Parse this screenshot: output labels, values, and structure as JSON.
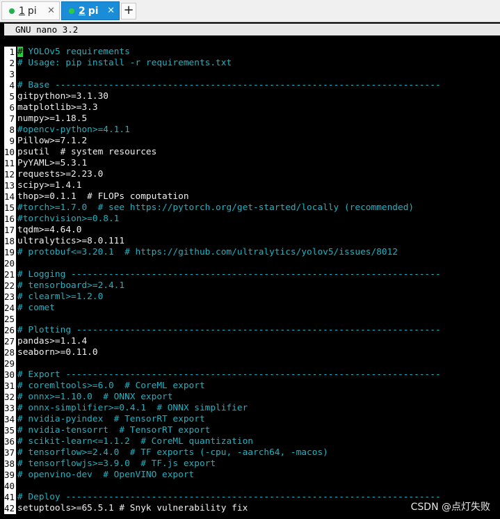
{
  "tabs": [
    {
      "number": "1",
      "label": "pi",
      "active": false
    },
    {
      "number": "2",
      "label": "pi",
      "active": true
    }
  ],
  "add_tab_label": "+",
  "close_glyph": "✕",
  "editor_title": "GNU nano 3.2",
  "colors": {
    "comment": "#1ab4c4",
    "text": "#f0f0f0",
    "active_tab": "#1a8cd8",
    "cursor": "#2ecc40"
  },
  "lines": [
    {
      "n": "1",
      "text": "# YOLOv5 requirements",
      "comment": true
    },
    {
      "n": "2",
      "text": "# Usage: pip install -r requirements.txt",
      "comment": true
    },
    {
      "n": "3",
      "text": "",
      "comment": false
    },
    {
      "n": "4",
      "text": "# Base ------------------------------------------------------------------------",
      "comment": true
    },
    {
      "n": "5",
      "text": "gitpython>=3.1.30",
      "comment": false
    },
    {
      "n": "6",
      "text": "matplotlib>=3.3",
      "comment": false
    },
    {
      "n": "7",
      "text": "numpy>=1.18.5",
      "comment": false
    },
    {
      "n": "8",
      "text": "#opencv-python>=4.1.1",
      "comment": true
    },
    {
      "n": "9",
      "text": "Pillow>=7.1.2",
      "comment": false
    },
    {
      "n": "10",
      "text": "psutil  # system resources",
      "comment": false
    },
    {
      "n": "11",
      "text": "PyYAML>=5.3.1",
      "comment": false
    },
    {
      "n": "12",
      "text": "requests>=2.23.0",
      "comment": false
    },
    {
      "n": "13",
      "text": "scipy>=1.4.1",
      "comment": false
    },
    {
      "n": "14",
      "text": "thop>=0.1.1  # FLOPs computation",
      "comment": false
    },
    {
      "n": "15",
      "text": "#torch>=1.7.0  # see https://pytorch.org/get-started/locally (recommended)",
      "comment": true
    },
    {
      "n": "16",
      "text": "#torchvision>=0.8.1",
      "comment": true
    },
    {
      "n": "17",
      "text": "tqdm>=4.64.0",
      "comment": false
    },
    {
      "n": "18",
      "text": "ultralytics>=8.0.111",
      "comment": false
    },
    {
      "n": "19",
      "text": "# protobuf<=3.20.1  # https://github.com/ultralytics/yolov5/issues/8012",
      "comment": true
    },
    {
      "n": "20",
      "text": "",
      "comment": false
    },
    {
      "n": "21",
      "text": "# Logging ---------------------------------------------------------------------",
      "comment": true
    },
    {
      "n": "22",
      "text": "# tensorboard>=2.4.1",
      "comment": true
    },
    {
      "n": "23",
      "text": "# clearml>=1.2.0",
      "comment": true
    },
    {
      "n": "24",
      "text": "# comet",
      "comment": true
    },
    {
      "n": "25",
      "text": "",
      "comment": false
    },
    {
      "n": "26",
      "text": "# Plotting --------------------------------------------------------------------",
      "comment": true
    },
    {
      "n": "27",
      "text": "pandas>=1.1.4",
      "comment": false
    },
    {
      "n": "28",
      "text": "seaborn>=0.11.0",
      "comment": false
    },
    {
      "n": "29",
      "text": "",
      "comment": false
    },
    {
      "n": "30",
      "text": "# Export ----------------------------------------------------------------------",
      "comment": true
    },
    {
      "n": "31",
      "text": "# coremltools>=6.0  # CoreML export",
      "comment": true
    },
    {
      "n": "32",
      "text": "# onnx>=1.10.0  # ONNX export",
      "comment": true
    },
    {
      "n": "33",
      "text": "# onnx-simplifier>=0.4.1  # ONNX simplifier",
      "comment": true
    },
    {
      "n": "34",
      "text": "# nvidia-pyindex  # TensorRT export",
      "comment": true
    },
    {
      "n": "35",
      "text": "# nvidia-tensorrt  # TensorRT export",
      "comment": true
    },
    {
      "n": "36",
      "text": "# scikit-learn<=1.1.2  # CoreML quantization",
      "comment": true
    },
    {
      "n": "37",
      "text": "# tensorflow>=2.4.0  # TF exports (-cpu, -aarch64, -macos)",
      "comment": true
    },
    {
      "n": "38",
      "text": "# tensorflowjs>=3.9.0  # TF.js export",
      "comment": true
    },
    {
      "n": "39",
      "text": "# openvino-dev  # OpenVINO export",
      "comment": true
    },
    {
      "n": "40",
      "text": "",
      "comment": false
    },
    {
      "n": "41",
      "text": "# Deploy ----------------------------------------------------------------------",
      "comment": true
    },
    {
      "n": "42",
      "text": "setuptools>=65.5.1 # Snyk vulnerability fix",
      "comment": false
    }
  ],
  "watermark": "CSDN @点灯失败"
}
